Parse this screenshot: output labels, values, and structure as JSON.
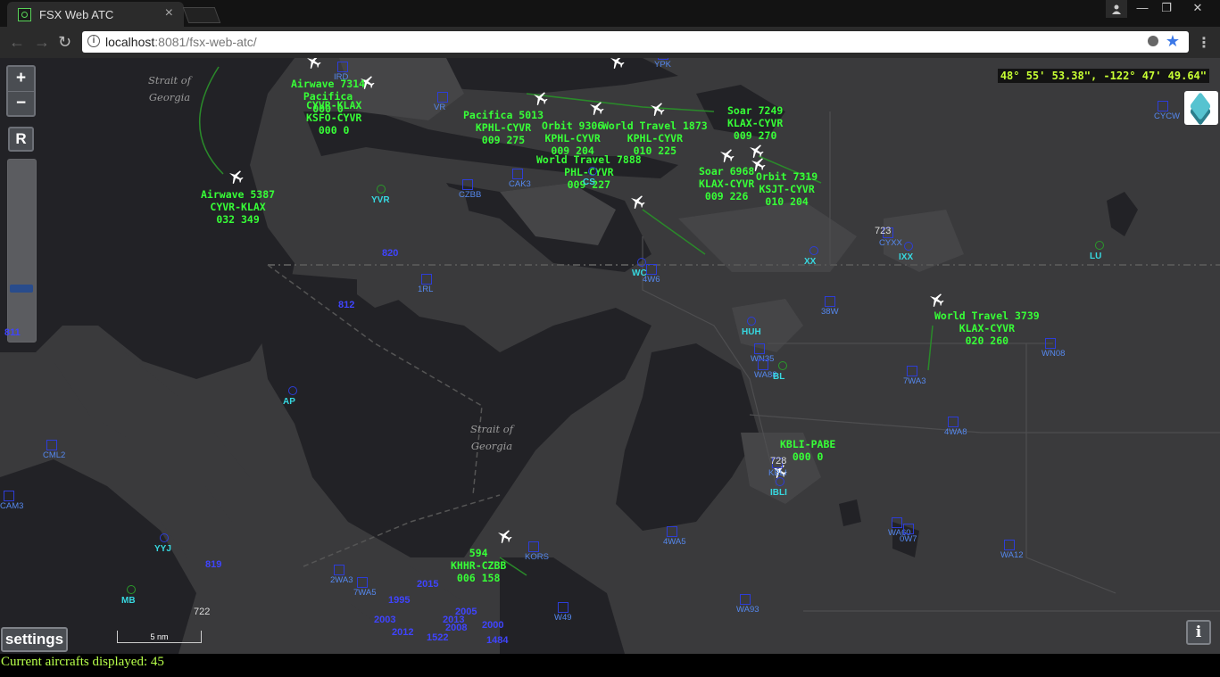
{
  "browser": {
    "tab_title": "FSX Web ATC",
    "tab_close": "×",
    "url_host": "localhost",
    "url_rest": ":8081/fsx-web-atc/",
    "win_min": "—",
    "win_max": "❐",
    "win_close": "✕"
  },
  "map": {
    "zoom_in": "+",
    "zoom_out": "−",
    "reset_label": "R",
    "coordinates": "48° 55' 53.38\", -122° 47' 49.64\"",
    "settings_label": "settings",
    "scale_label": "5 nm",
    "info_label": "i",
    "water_labels": [
      {
        "l1": "Strait of",
        "l2": "Georgia"
      },
      {
        "l1": "Strait of",
        "l2": "Georgia"
      }
    ],
    "aircraft": [
      {
        "callsign": "Airwave 5387",
        "route": "CYVR-KLAX",
        "data": "032 349"
      },
      {
        "callsign": "Pacifica 5013",
        "route": "KPHL-CYVR",
        "data": "009 275"
      },
      {
        "callsign": "World Travel 1873",
        "route": "KPHL-CYVR",
        "data": "010 225"
      },
      {
        "callsign": "Orbit 9306",
        "route": "KPHL-CYVR",
        "data": "009 204"
      },
      {
        "callsign": "World Travel 7888",
        "route": "PHL-CYVR",
        "data": "009 227"
      },
      {
        "callsign": "Soar 7249",
        "route": "KLAX-CYVR",
        "data": "009 270"
      },
      {
        "callsign": "Soar 6968",
        "route": "KLAX-CYVR",
        "data": "009 226"
      },
      {
        "callsign": "Orbit 7319",
        "route": "KSJT-CYVR",
        "data": "010 204"
      },
      {
        "callsign": "World Travel 3739",
        "route": "KLAX-CYVR",
        "data": "020 260"
      },
      {
        "callsign": "KBLI-PABE",
        "route": "000 0",
        "data": ""
      },
      {
        "callsign": "594",
        "route": "KHHR-CZBB",
        "data": "006 158"
      },
      {
        "callsign": "Airwave 7314",
        "route": "Pacifica",
        "data": "000 0"
      },
      {
        "callsign": "CYVR-KLAX",
        "route": "KSFO-CYVR",
        "data": "000 0"
      }
    ],
    "fixes": [
      "YPK",
      "VR",
      "CZBB",
      "CAK3",
      "CYCW",
      "1RL",
      "4W6",
      "38W",
      "WN35",
      "WA88",
      "WN08",
      "7WA3",
      "4WA8",
      "CML2",
      "CAM3",
      "KORS",
      "2WA3",
      "7WA5",
      "W49",
      "WA93",
      "4WA5",
      "WA60",
      "0W7",
      "WA12",
      "CYXX",
      "KBLI",
      "IRD"
    ],
    "navaids": [
      "YVR",
      "WC",
      "HUH",
      "BL",
      "XX",
      "IXX",
      "LU",
      "AP",
      "YYJ",
      "MB",
      "IBLI",
      "CS"
    ],
    "traffic_alts": [
      "820",
      "812",
      "811",
      "819",
      "1995",
      "2015",
      "2003",
      "2012",
      "2000",
      "2005",
      "1522",
      "2008",
      "2013",
      "1484",
      "723",
      "728",
      "722"
    ]
  },
  "status": {
    "text": "Current aircrafts displayed: 45"
  },
  "colors": {
    "land": "#3a3a3c",
    "water": "#222226",
    "aircraft_label": "#37ff37",
    "fix": "#2d3dd8",
    "navaid": "#37d8e0",
    "status_text": "#b7ff4a"
  }
}
